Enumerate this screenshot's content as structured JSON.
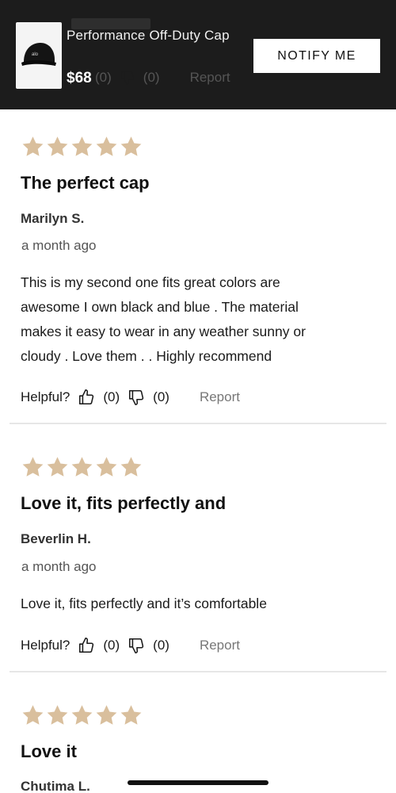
{
  "sticky_bar": {
    "product_name": "Performance Off-Duty Cap",
    "price": "$68",
    "notify_label": "NOTIFY ME",
    "thumb_logo": "alo",
    "thumb_icon": "cap-icon"
  },
  "ghost_row": {
    "up_count": "(0)",
    "down_count": "(0)",
    "report": "Report"
  },
  "colors": {
    "star": "#d9bf9d",
    "bar_bg": "#1c1c1c",
    "divider": "#e6e6e6"
  },
  "reviews": [
    {
      "rating": 5,
      "title": "The perfect cap",
      "author": "Marilyn S.",
      "date": "a month ago",
      "body_lines": [
        "This is my second one fits great colors are",
        "awesome I own black and blue . The material",
        "makes it easy to wear in any weather sunny or",
        "cloudy . Love them . . Highly recommend"
      ],
      "helpful_label": "Helpful?",
      "up_count": "(0)",
      "down_count": "(0)",
      "report": "Report"
    },
    {
      "rating": 5,
      "title": "Love it, fits perfectly and",
      "author": "Beverlin H.",
      "date": "a month ago",
      "body_lines": [
        "Love it, fits perfectly and it’s comfortable"
      ],
      "helpful_label": "Helpful?",
      "up_count": "(0)",
      "down_count": "(0)",
      "report": "Report"
    },
    {
      "rating": 5,
      "title": "Love it",
      "author": "Chutima L."
    }
  ]
}
